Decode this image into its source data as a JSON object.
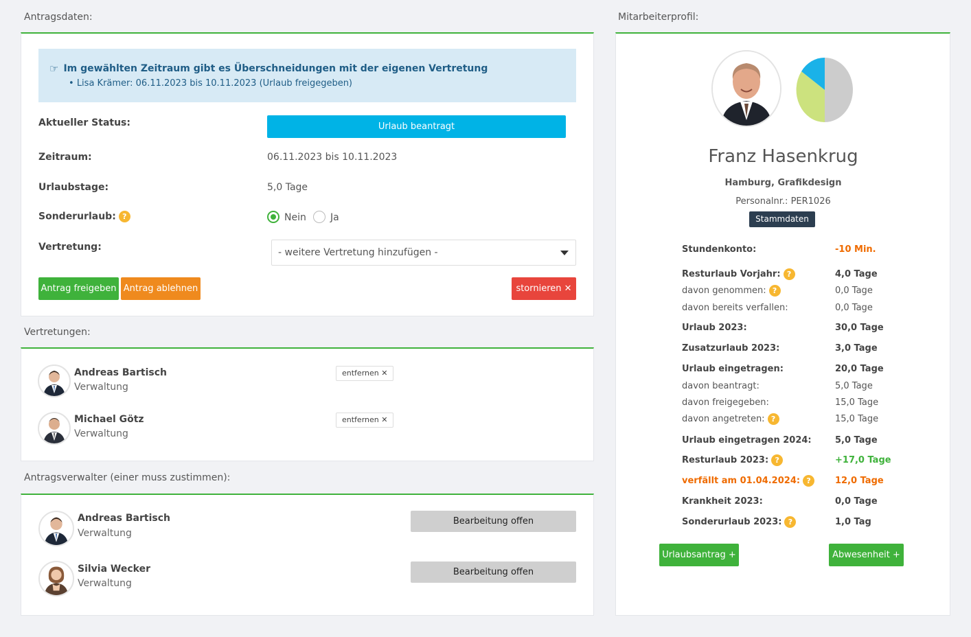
{
  "titles": {
    "antragsdaten": "Antragsdaten:",
    "mitarbeiterprofil": "Mitarbeiterprofil:",
    "vertretungen": "Vertretungen:",
    "antragsverwalter": "Antragsverwalter (einer muss zustimmen):"
  },
  "alert": {
    "heading": "Im gewählten Zeitraum gibt es Überschneidungen mit der eigenen Vertretung",
    "item": "Lisa Krämer: 06.11.2023 bis 10.11.2023 (Urlaub freigegeben)"
  },
  "form": {
    "status_label": "Aktueller Status:",
    "status_value": "Urlaub beantragt",
    "zeitraum_label": "Zeitraum:",
    "zeitraum_value": "06.11.2023 bis 10.11.2023",
    "urlaubstage_label": "Urlaubstage:",
    "urlaubstage_value": "5,0 Tage",
    "sonderurlaub_label": "Sonderurlaub:",
    "radio_nein": "Nein",
    "radio_ja": "Ja",
    "vertretung_label": "Vertretung:",
    "vertretung_select": "- weitere Vertretung hinzufügen -",
    "btn_freigeben": "Antrag freigeben",
    "btn_ablehnen": "Antrag ablehnen",
    "btn_stornieren": "stornieren ✕"
  },
  "vertretungen": [
    {
      "name": "Andreas Bartisch",
      "dept": "Verwaltung",
      "action": "entfernen ✕"
    },
    {
      "name": "Michael Götz",
      "dept": "Verwaltung",
      "action": "entfernen ✕"
    }
  ],
  "verwalter": [
    {
      "name": "Andreas Bartisch",
      "dept": "Verwaltung",
      "status": "Bearbeitung offen"
    },
    {
      "name": "Silvia Wecker",
      "dept": "Verwaltung",
      "status": "Bearbeitung offen"
    }
  ],
  "profile": {
    "name": "Franz Hasenkrug",
    "location": "Hamburg, Grafikdesign",
    "personalnr": "Personalnr.: PER1026",
    "stammdaten": "Stammdaten ➔]",
    "stats": [
      {
        "label": "Stundenkonto:",
        "value": "-10 Min."
      },
      {
        "label": "Resturlaub Vorjahr:",
        "value": "4,0 Tage"
      },
      {
        "label": "davon genommen:",
        "value": "0,0 Tage"
      },
      {
        "label": "davon bereits verfallen:",
        "value": "0,0 Tage"
      },
      {
        "label": "Urlaub 2023:",
        "value": "30,0 Tage"
      },
      {
        "label": "Zusatzurlaub 2023:",
        "value": "3,0 Tage"
      },
      {
        "label": "Urlaub eingetragen:",
        "value": "20,0 Tage"
      },
      {
        "label": "davon beantragt:",
        "value": "5,0 Tage"
      },
      {
        "label": "davon freigegeben:",
        "value": "15,0 Tage"
      },
      {
        "label": "davon angetreten:",
        "value": "15,0 Tage"
      },
      {
        "label": "Urlaub eingetragen 2024:",
        "value": "5,0 Tage"
      },
      {
        "label": "Resturlaub 2023:",
        "value": "+17,0 Tage"
      },
      {
        "label": "verfällt am 01.04.2024:",
        "value": "12,0 Tage"
      },
      {
        "label": "Krankheit 2023:",
        "value": "0,0 Tage"
      },
      {
        "label": "Sonderurlaub 2023:",
        "value": "1,0 Tag"
      }
    ],
    "btn_urlaubsantrag": "Urlaubsantrag +",
    "btn_abwesenheit": "Abwesenheit +"
  },
  "colors": {
    "accent_green": "#3fb23b",
    "status_blue": "#00b3e6",
    "danger_red": "#e8453c",
    "warning_orange": "#ef8a1e",
    "help_yellow": "#f7b731",
    "pie_grey": "#cccccc",
    "pie_lime": "#cce27e",
    "pie_blue": "#1ab2e8"
  },
  "icons": {
    "alert": "pointing-hand-icon",
    "help": "help-icon",
    "remove": "close-icon",
    "dropdown": "chevron-down-icon",
    "login": "login-icon",
    "add": "plus-icon"
  }
}
